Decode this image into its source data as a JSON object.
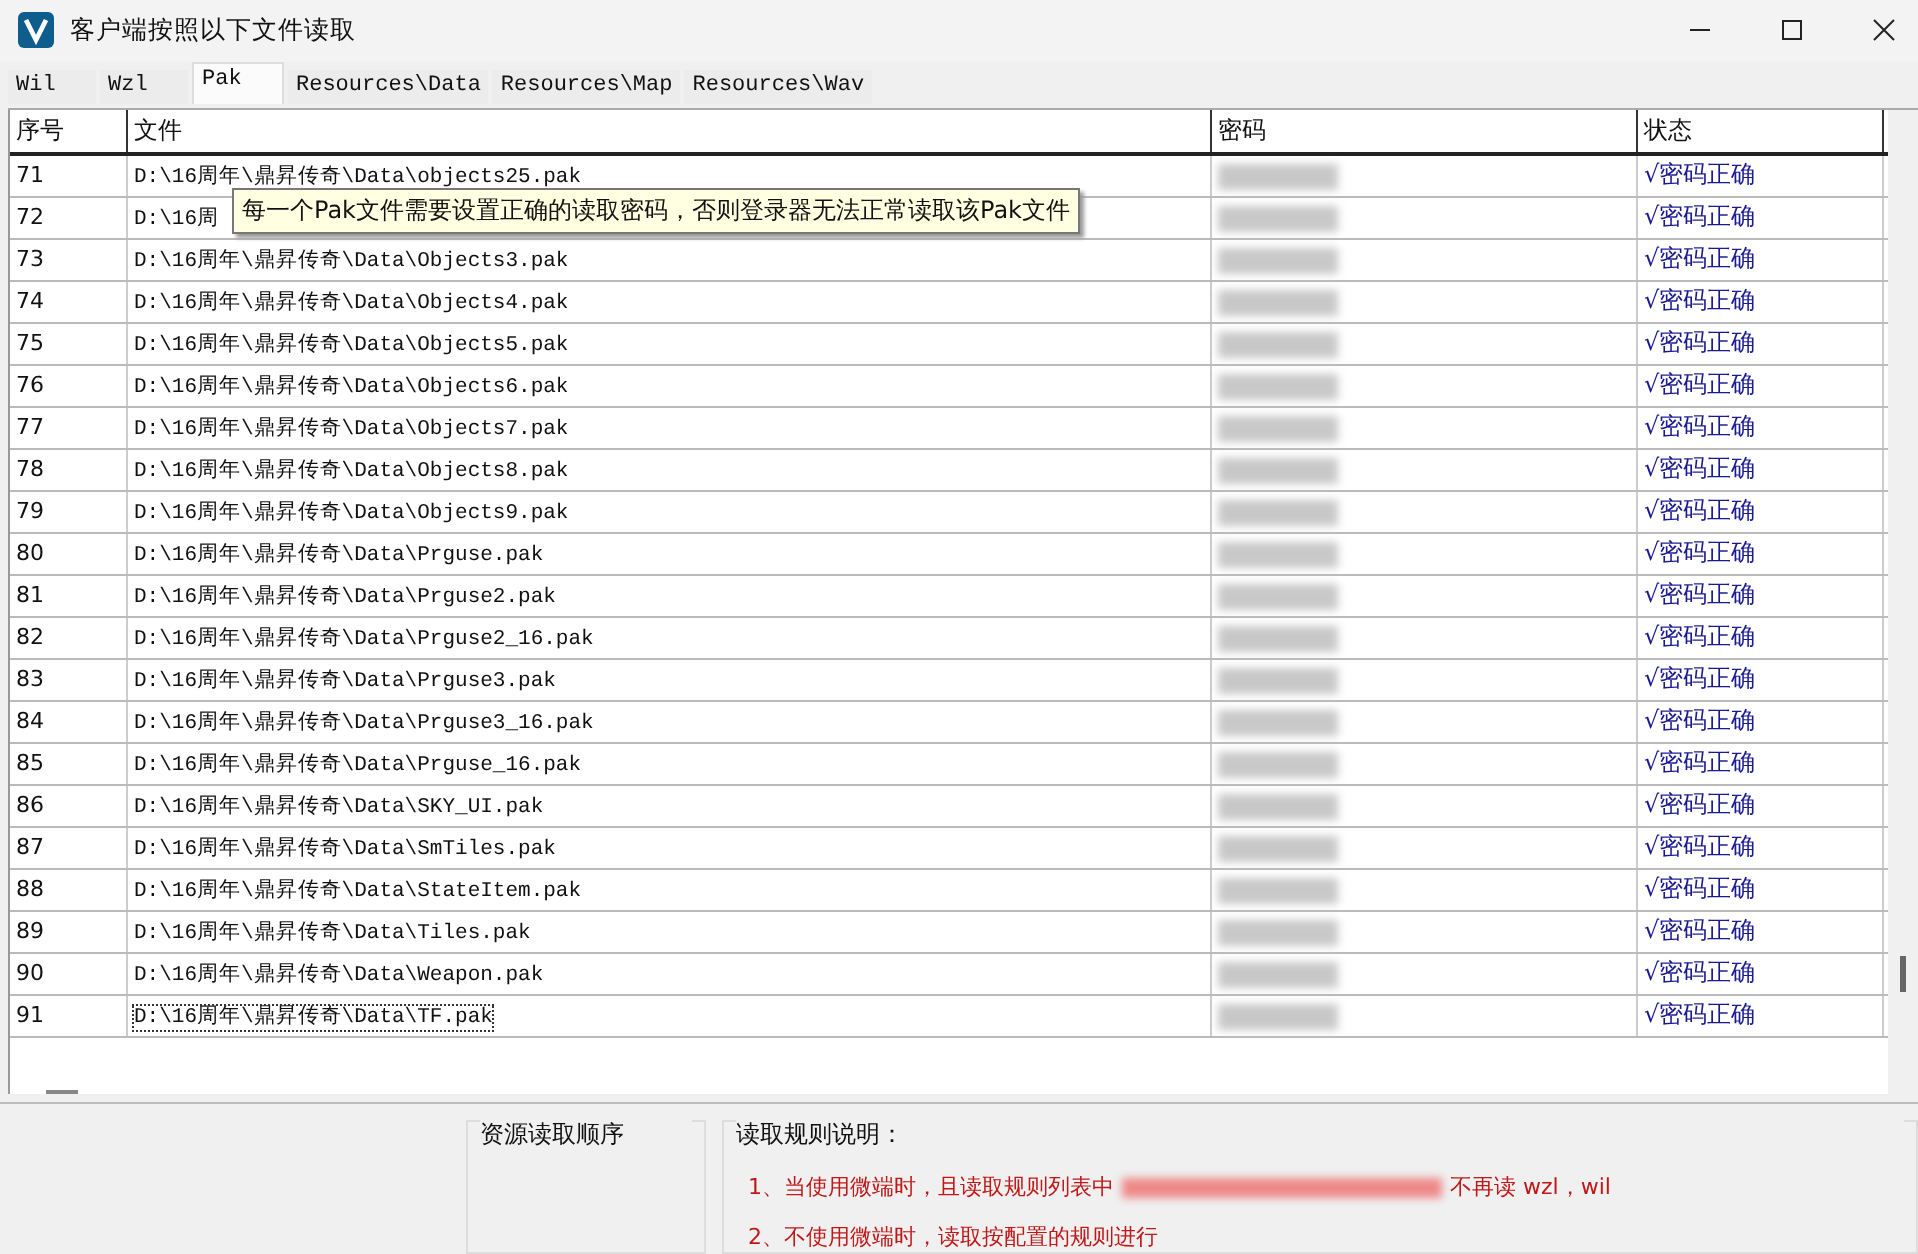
{
  "window": {
    "title": "客户端按照以下文件读取"
  },
  "tabs": [
    {
      "label": "Wil",
      "selected": false
    },
    {
      "label": "Wzl",
      "selected": false
    },
    {
      "label": "Pak",
      "selected": true
    },
    {
      "label": "Resources\\Data",
      "selected": false
    },
    {
      "label": "Resources\\Map",
      "selected": false
    },
    {
      "label": "Resources\\Wav",
      "selected": false
    }
  ],
  "table": {
    "columns": [
      "序号",
      "文件",
      "密码",
      "状态"
    ],
    "rows": [
      {
        "index": "71",
        "file": "D:\\16周年\\鼎昇传奇\\Data\\objects25.pak",
        "status": "√密码正确",
        "selected": false
      },
      {
        "index": "72",
        "file": "D:\\16周",
        "status": "√密码正确",
        "selected": false
      },
      {
        "index": "73",
        "file": "D:\\16周年\\鼎昇传奇\\Data\\Objects3.pak",
        "status": "√密码正确",
        "selected": false
      },
      {
        "index": "74",
        "file": "D:\\16周年\\鼎昇传奇\\Data\\Objects4.pak",
        "status": "√密码正确",
        "selected": false
      },
      {
        "index": "75",
        "file": "D:\\16周年\\鼎昇传奇\\Data\\Objects5.pak",
        "status": "√密码正确",
        "selected": false
      },
      {
        "index": "76",
        "file": "D:\\16周年\\鼎昇传奇\\Data\\Objects6.pak",
        "status": "√密码正确",
        "selected": false
      },
      {
        "index": "77",
        "file": "D:\\16周年\\鼎昇传奇\\Data\\Objects7.pak",
        "status": "√密码正确",
        "selected": false
      },
      {
        "index": "78",
        "file": "D:\\16周年\\鼎昇传奇\\Data\\Objects8.pak",
        "status": "√密码正确",
        "selected": false
      },
      {
        "index": "79",
        "file": "D:\\16周年\\鼎昇传奇\\Data\\Objects9.pak",
        "status": "√密码正确",
        "selected": false
      },
      {
        "index": "80",
        "file": "D:\\16周年\\鼎昇传奇\\Data\\Prguse.pak",
        "status": "√密码正确",
        "selected": false
      },
      {
        "index": "81",
        "file": "D:\\16周年\\鼎昇传奇\\Data\\Prguse2.pak",
        "status": "√密码正确",
        "selected": false
      },
      {
        "index": "82",
        "file": "D:\\16周年\\鼎昇传奇\\Data\\Prguse2_16.pak",
        "status": "√密码正确",
        "selected": false
      },
      {
        "index": "83",
        "file": "D:\\16周年\\鼎昇传奇\\Data\\Prguse3.pak",
        "status": "√密码正确",
        "selected": false
      },
      {
        "index": "84",
        "file": "D:\\16周年\\鼎昇传奇\\Data\\Prguse3_16.pak",
        "status": "√密码正确",
        "selected": false
      },
      {
        "index": "85",
        "file": "D:\\16周年\\鼎昇传奇\\Data\\Prguse_16.pak",
        "status": "√密码正确",
        "selected": false
      },
      {
        "index": "86",
        "file": "D:\\16周年\\鼎昇传奇\\Data\\SKY_UI.pak",
        "status": "√密码正确",
        "selected": false
      },
      {
        "index": "87",
        "file": "D:\\16周年\\鼎昇传奇\\Data\\SmTiles.pak",
        "status": "√密码正确",
        "selected": false
      },
      {
        "index": "88",
        "file": "D:\\16周年\\鼎昇传奇\\Data\\StateItem.pak",
        "status": "√密码正确",
        "selected": false
      },
      {
        "index": "89",
        "file": "D:\\16周年\\鼎昇传奇\\Data\\Tiles.pak",
        "status": "√密码正确",
        "selected": false
      },
      {
        "index": "90",
        "file": "D:\\16周年\\鼎昇传奇\\Data\\Weapon.pak",
        "status": "√密码正确",
        "selected": false
      },
      {
        "index": "91",
        "file": "D:\\16周年\\鼎昇传奇\\Data\\TF.pak",
        "status": "√密码正确",
        "selected": true
      }
    ]
  },
  "tooltip": {
    "text": "每一个Pak文件需要设置正确的读取密码，否则登录器无法正常读取该Pak文件"
  },
  "order_panel": {
    "title": "资源读取顺序"
  },
  "rules_panel": {
    "title": "读取规则说明：",
    "rules": [
      {
        "before": "1、当使用微端时，且读取规则列表中",
        "after": "不再读 wzl，wil"
      },
      {
        "before": "2、不使用微端时，读取按配置的规则进行"
      }
    ]
  }
}
